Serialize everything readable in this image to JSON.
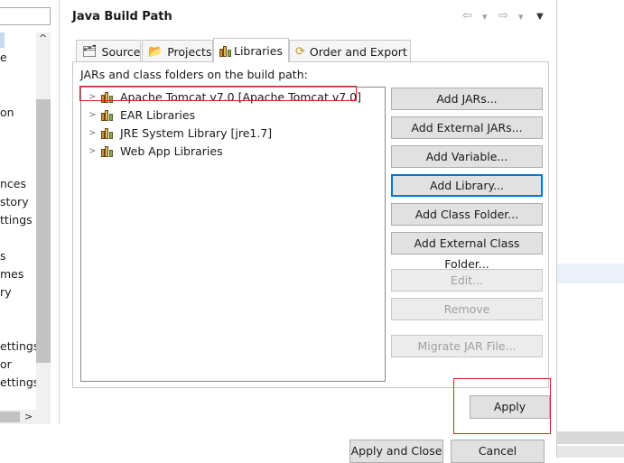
{
  "left_nav": {
    "fragments": [
      "e",
      "on",
      "nces",
      "story",
      "ttings",
      "s",
      "mes",
      "ry",
      "ettings",
      "or",
      "ettings"
    ],
    "scroll_up": "^",
    "scroll_right": ">"
  },
  "header": {
    "title": "Java Build Path",
    "back_icon": "⇦",
    "back_dropdown": "▾",
    "forward_icon": "⇨",
    "forward_dropdown": "▾",
    "view_menu_icon": "▼"
  },
  "tabs": [
    {
      "label": "Source",
      "icon": "folder-source-icon",
      "active": false
    },
    {
      "label": "Projects",
      "icon": "projects-icon",
      "active": false
    },
    {
      "label": "Libraries",
      "icon": "libraries-icon",
      "active": true
    },
    {
      "label": "Order and Export",
      "icon": "order-export-icon",
      "active": false
    }
  ],
  "build_path_label": "JARs and class folders on the build path:",
  "tree": [
    {
      "label": "Apache Tomcat v7.0 [Apache Tomcat v7.0]",
      "chevron": ">"
    },
    {
      "label": "EAR Libraries",
      "chevron": ">"
    },
    {
      "label": "JRE System Library [jre1.7]",
      "chevron": ">"
    },
    {
      "label": "Web App Libraries",
      "chevron": ">"
    }
  ],
  "buttons": {
    "add_jars": "Add JARs...",
    "add_external_jars": "Add External JARs...",
    "add_variable": "Add Variable...",
    "add_library": "Add Library...",
    "add_class_folder": "Add Class Folder...",
    "add_external_class_folder": "Add External Class Folder...",
    "edit": "Edit...",
    "remove": "Remove",
    "migrate_jar": "Migrate JAR File...",
    "apply": "Apply",
    "apply_and_close": "Apply and Close",
    "cancel": "Cancel"
  },
  "colors": {
    "focus_border": "#0078d7",
    "annotation_red": "#e02020",
    "disabled_text": "#a0a0a0"
  }
}
